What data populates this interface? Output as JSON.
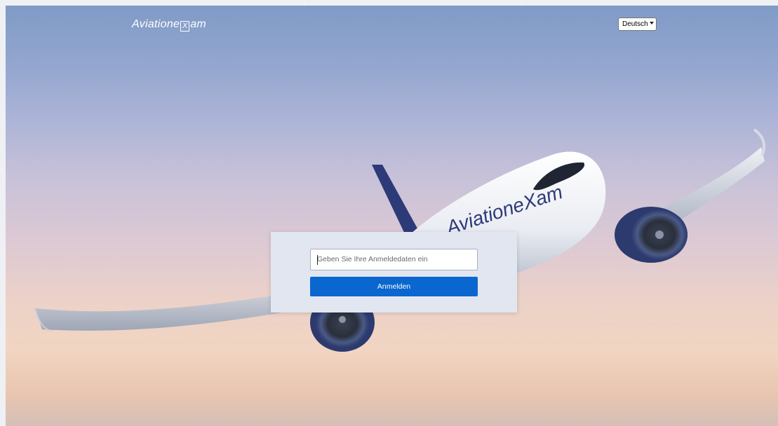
{
  "header": {
    "brand_prefix": "Aviatione",
    "brand_box": "X",
    "brand_suffix": "am",
    "language_select": {
      "selected": "Deutsch"
    }
  },
  "login": {
    "input_placeholder": "Geben Sie Ihre Anmeldedaten ein",
    "submit_label": "Anmelden"
  },
  "aircraft_livery": "AviationeXam",
  "colors": {
    "accent_button": "#0b67d0",
    "card_background": "#e1e6f1"
  }
}
